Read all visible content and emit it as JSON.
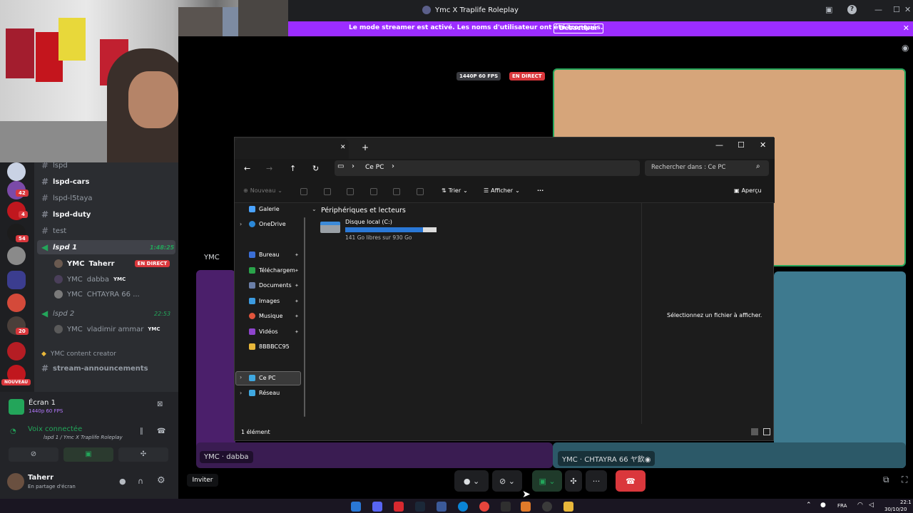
{
  "topbar": {
    "title": "Ymc X Traplife Roleplay",
    "minimize": "—",
    "maximize": "☐",
    "close": "✕",
    "help": "?"
  },
  "streamer_banner": {
    "message": "Le mode streamer est activé. Les noms d'utilisateur ont été tronqués.",
    "button": "Désactiver",
    "close": "✕"
  },
  "servers": {
    "badges": [
      "42",
      "4",
      "54",
      "20"
    ],
    "new_label": "NOUVEAU"
  },
  "channels": [
    {
      "name": "lspd",
      "type": "text",
      "bold": false
    },
    {
      "name": "lspd-cars",
      "type": "text",
      "bold": true
    },
    {
      "name": "lspd-l5taya",
      "type": "text",
      "bold": false
    },
    {
      "name": "lspd-duty",
      "type": "text",
      "bold": true
    },
    {
      "name": "test",
      "type": "text",
      "bold": false
    },
    {
      "name": "lspd 1",
      "type": "voice",
      "bold": true,
      "time": "1:48:25"
    },
    {
      "name": "lspd 2",
      "type": "voice",
      "bold": false,
      "time": "22:53"
    },
    {
      "name": "YMC content creator",
      "type": "category",
      "bold": false
    },
    {
      "name": "stream-announcements",
      "type": "text",
      "bold": false
    }
  ],
  "voice_members": {
    "lspd1": [
      {
        "tag": "YMC",
        "name": "Taherr",
        "live": "EN DIRECT"
      },
      {
        "tag": "YMC",
        "name": "dabba",
        "role": "YMC"
      },
      {
        "tag": "YMC",
        "name": "CHTAYRA 66 ..."
      }
    ],
    "lspd2": [
      {
        "tag": "YMC",
        "name": "vladimir ammar",
        "role": "YMC"
      }
    ]
  },
  "screen_share": {
    "title": "Écran 1",
    "quality": "1440p 60 FPS",
    "voice_status": "Voix connectée",
    "voice_channel": "lspd 1 / Ymc X Traplife Roleplay"
  },
  "user": {
    "name": "Taherr",
    "status": "En partage d'écran"
  },
  "invite_label": "Inviter",
  "stage": {
    "quality_badge": "1440P 60 FPS",
    "live_badge": "EN DIRECT",
    "tile_ymc_label": "YMC",
    "tile_dabba": "dabba",
    "tile_chtayra": "CHTAYRA 66 ヤ飲◉",
    "tile_tag": "YMC"
  },
  "explorer": {
    "tab_close": "✕",
    "tab_new": "+",
    "path": "Ce PC",
    "search_placeholder": "Rechercher dans : Ce PC",
    "toolbar": {
      "new": "Nouveau",
      "sort": "Trier",
      "view": "Afficher",
      "more": "···",
      "preview": "Aperçu"
    },
    "nav": [
      {
        "label": "Galerie",
        "color": "#4aa3ff",
        "pinned": false
      },
      {
        "label": "OneDrive",
        "color": "#2b88d8",
        "pinned": false
      },
      {
        "label": "Bureau",
        "color": "#3b6fd6",
        "pinned": true
      },
      {
        "label": "Téléchargem",
        "color": "#2aa34a",
        "pinned": true
      },
      {
        "label": "Documents",
        "color": "#6b7fa8",
        "pinned": true
      },
      {
        "label": "Images",
        "color": "#3c9be0",
        "pinned": true
      },
      {
        "label": "Musique",
        "color": "#e0553c",
        "pinned": true
      },
      {
        "label": "Vidéos",
        "color": "#8e44cc",
        "pinned": true
      },
      {
        "label": "8BBBCC95",
        "color": "#e8b73a",
        "pinned": false
      },
      {
        "label": "Ce PC",
        "color": "#3fa8e0",
        "pinned": false
      },
      {
        "label": "Réseau",
        "color": "#3fa8e0",
        "pinned": false
      }
    ],
    "section_title": "Périphériques et lecteurs",
    "drive": {
      "name": "Disque local (C:)",
      "usage": "141 Go libres sur 930 Go",
      "used_fraction": 0.85
    },
    "preview_text": "Sélectionnez un fichier à afficher.",
    "status": "1 élément"
  },
  "taskbar": {
    "lang": "FRA",
    "clock_top": "22:1",
    "clock_bottom": "30/10/20"
  },
  "colors": {
    "discord_purple": "#9c2dff",
    "live_red": "#da373c",
    "online_green": "#23a55a",
    "hangup_red": "#da373c"
  }
}
